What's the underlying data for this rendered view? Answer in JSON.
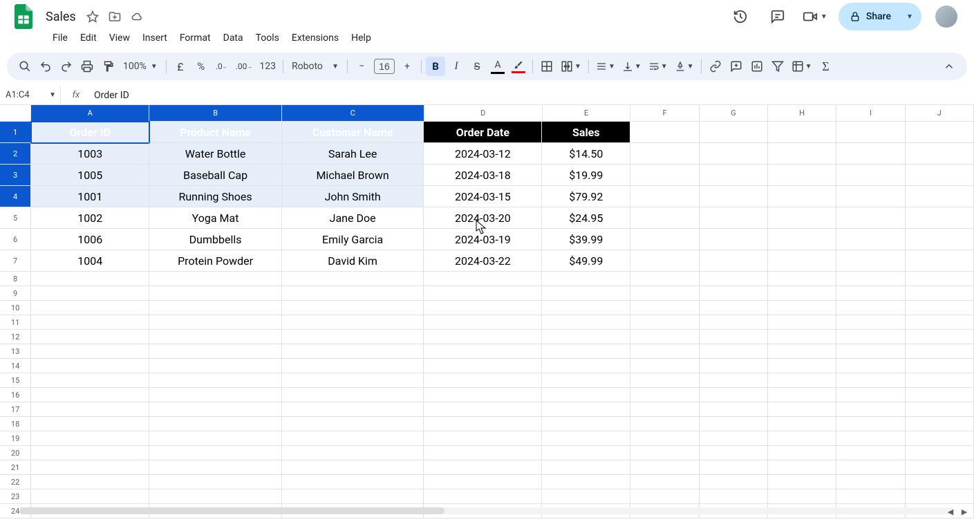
{
  "doc": {
    "title": "Sales"
  },
  "menus": [
    "File",
    "Edit",
    "View",
    "Insert",
    "Format",
    "Data",
    "Tools",
    "Extensions",
    "Help"
  ],
  "share": {
    "label": "Share"
  },
  "toolbar": {
    "zoom": "100%",
    "font": "Roboto",
    "fontsize": "16",
    "fmt123": "123"
  },
  "namebox": "A1:C4",
  "formula": "Order ID",
  "columns": [
    "A",
    "B",
    "C",
    "D",
    "E",
    "F",
    "G",
    "H",
    "I",
    "J"
  ],
  "table": {
    "headers": [
      "Order ID",
      "Product Name",
      "Customer Name",
      "Order Date",
      "Sales"
    ],
    "rows": [
      [
        "1003",
        "Water Bottle",
        "Sarah Lee",
        "2024-03-12",
        "$14.50"
      ],
      [
        "1005",
        "Baseball Cap",
        "Michael Brown",
        "2024-03-18",
        "$19.99"
      ],
      [
        "1001",
        "Running Shoes",
        "John Smith",
        "2024-03-15",
        "$79.92"
      ],
      [
        "1002",
        "Yoga Mat",
        "Jane Doe",
        "2024-03-20",
        "$24.95"
      ],
      [
        "1006",
        "Dumbbells",
        "Emily Garcia",
        "2024-03-19",
        "$39.99"
      ],
      [
        "1004",
        "Protein Powder",
        "David Kim",
        "2024-03-22",
        "$49.99"
      ]
    ]
  },
  "chart_data": {
    "type": "table",
    "title": "Sales",
    "headers": [
      "Order ID",
      "Product Name",
      "Customer Name",
      "Order Date",
      "Sales"
    ],
    "rows": [
      {
        "Order ID": 1003,
        "Product Name": "Water Bottle",
        "Customer Name": "Sarah Lee",
        "Order Date": "2024-03-12",
        "Sales": 14.5
      },
      {
        "Order ID": 1005,
        "Product Name": "Baseball Cap",
        "Customer Name": "Michael Brown",
        "Order Date": "2024-03-18",
        "Sales": 19.99
      },
      {
        "Order ID": 1001,
        "Product Name": "Running Shoes",
        "Customer Name": "John Smith",
        "Order Date": "2024-03-15",
        "Sales": 79.92
      },
      {
        "Order ID": 1002,
        "Product Name": "Yoga Mat",
        "Customer Name": "Jane Doe",
        "Order Date": "2024-03-20",
        "Sales": 24.95
      },
      {
        "Order ID": 1006,
        "Product Name": "Dumbbells",
        "Customer Name": "Emily Garcia",
        "Order Date": "2024-03-19",
        "Sales": 39.99
      },
      {
        "Order ID": 1004,
        "Product Name": "Protein Powder",
        "Customer Name": "David Kim",
        "Order Date": "2024-03-22",
        "Sales": 49.99
      }
    ]
  }
}
